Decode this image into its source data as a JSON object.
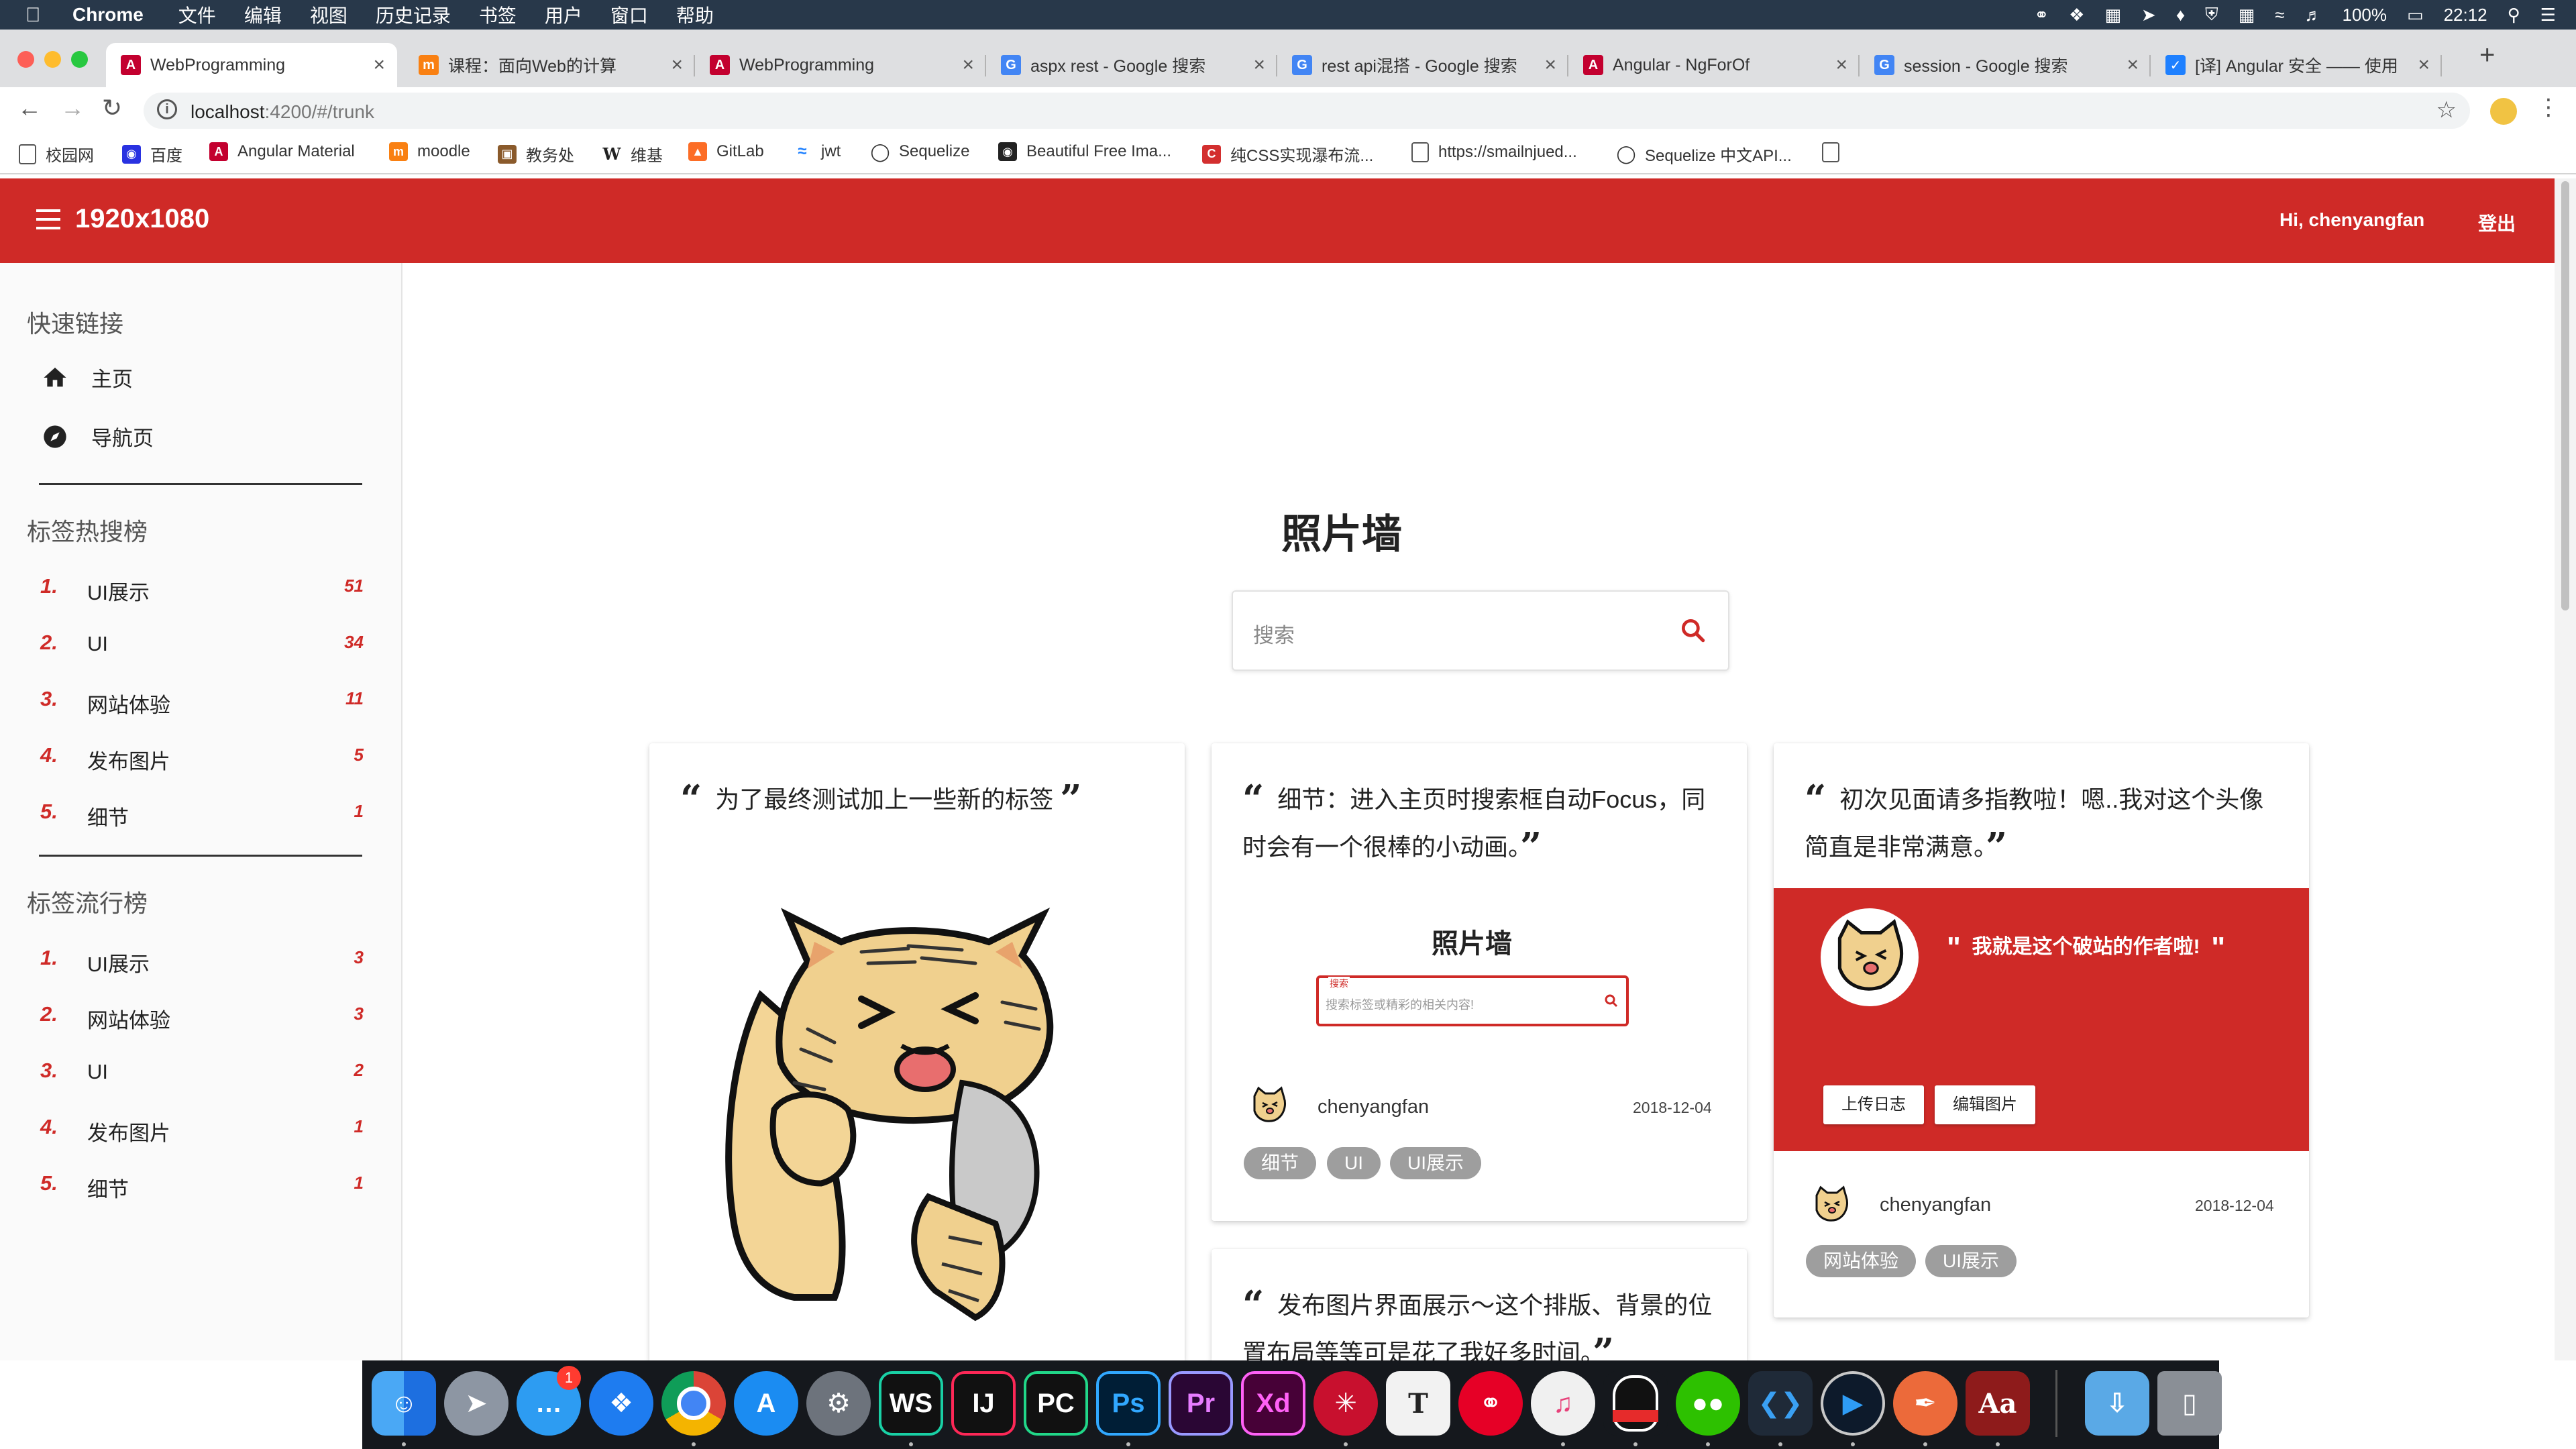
{
  "menubar": {
    "app": "Chrome",
    "menus": [
      "文件",
      "编辑",
      "视图",
      "历史记录",
      "书签",
      "用户",
      "窗口",
      "帮助"
    ],
    "battery": "100%",
    "time": "22:12"
  },
  "tabs": [
    {
      "label": "WebProgramming",
      "favicon": "angular-icon",
      "active": true
    },
    {
      "label": "课程：面向Web的计算",
      "favicon": "moodle-icon"
    },
    {
      "label": "WebProgramming",
      "favicon": "angular-icon"
    },
    {
      "label": "aspx rest - Google 搜索",
      "favicon": "google-icon"
    },
    {
      "label": "rest api混搭 - Google 搜索",
      "favicon": "google-icon"
    },
    {
      "label": "Angular - NgForOf",
      "favicon": "angular-icon"
    },
    {
      "label": "session - Google 搜索",
      "favicon": "google-icon"
    },
    {
      "label": "[译] Angular 安全 —— 使用",
      "favicon": "juejin-icon"
    }
  ],
  "address": {
    "host": "localhost",
    "path": ":4200/#/trunk"
  },
  "bookmarks": [
    "校园网",
    "百度",
    "Angular Material",
    "moodle",
    "教务处",
    "维基",
    "GitLab",
    "jwt",
    "Sequelize",
    "Beautiful Free Ima...",
    "纯CSS实现瀑布流...",
    "https://smailnjued...",
    "Sequelize 中文API..."
  ],
  "header": {
    "title": "1920x1080",
    "greeting": "Hi, chenyangfan",
    "logout": "登出"
  },
  "sidebar": {
    "quick_title": "快速链接",
    "links": [
      {
        "label": "主页",
        "icon": "home-icon"
      },
      {
        "label": "导航页",
        "icon": "compass-icon"
      }
    ],
    "hot_title": "标签热搜榜",
    "hot": [
      {
        "rank": "1.",
        "label": "UI展示",
        "count": "51"
      },
      {
        "rank": "2.",
        "label": "UI",
        "count": "34"
      },
      {
        "rank": "3.",
        "label": "网站体验",
        "count": "11"
      },
      {
        "rank": "4.",
        "label": "发布图片",
        "count": "5"
      },
      {
        "rank": "5.",
        "label": "细节",
        "count": "1"
      }
    ],
    "popular_title": "标签流行榜",
    "popular": [
      {
        "rank": "1.",
        "label": "UI展示",
        "count": "3"
      },
      {
        "rank": "2.",
        "label": "网站体验",
        "count": "3"
      },
      {
        "rank": "3.",
        "label": "UI",
        "count": "2"
      },
      {
        "rank": "4.",
        "label": "发布图片",
        "count": "1"
      },
      {
        "rank": "5.",
        "label": "细节",
        "count": "1"
      }
    ]
  },
  "main": {
    "title": "照片墙",
    "search_placeholder": "搜索"
  },
  "cards": {
    "c1": {
      "text": "为了最终测试加上一些新的标签"
    },
    "c2": {
      "text_line1": "细节：进入主页时搜索框自动Focus，同",
      "text_line2": "时会有一个很棒的小动画。",
      "mini_title": "照片墙",
      "mini_label": "搜索",
      "mini_placeholder": "搜索标签或精彩的相关内容!",
      "author": "chenyangfan",
      "date": "2018-12-04",
      "tags": [
        "细节",
        "UI",
        "UI展示"
      ]
    },
    "c3": {
      "text_line1": "初次见面请多指教啦！嗯..我对这个头像",
      "text_line2": "简直是非常满意。",
      "banner_quote": "我就是这个破站的作者啦!",
      "btn_upload": "上传日志",
      "btn_edit": "编辑图片",
      "author": "chenyangfan",
      "date": "2018-12-04",
      "tags": [
        "网站体验",
        "UI展示"
      ]
    },
    "c4": {
      "text_line1": "发布图片界面展示～这个排版、背景的位",
      "text_line2": "置布局等等可是花了我好多时间。"
    }
  },
  "dock": {
    "apps": [
      "finder-icon",
      "launchpad-icon",
      "messages-icon",
      "safari-icon",
      "chrome-icon",
      "app-store-icon",
      "system-preferences-icon",
      "webstorm-icon",
      "intellij-icon",
      "pycharm-icon",
      "photoshop-icon",
      "premiere-icon",
      "xd-icon",
      "pastebot-icon",
      "typora-icon",
      "netease-music-icon",
      "itunes-icon",
      "qq-icon",
      "wechat-icon",
      "vscode-icon",
      "quicktime-icon",
      "paw-icon",
      "dictionary-icon",
      "downloads-icon",
      "trash-icon"
    ],
    "labels": {
      "webstorm": "WS",
      "intellij": "IJ",
      "pycharm": "PC",
      "photoshop": "Ps",
      "premiere": "Pr",
      "xd": "Xd",
      "typora": "T",
      "dictionary": "Aa"
    },
    "messages_badge": "1"
  },
  "colors": {
    "brand_red": "#cf2a27",
    "tag_grey": "#9e9e9e",
    "menubar": "#28384a"
  }
}
